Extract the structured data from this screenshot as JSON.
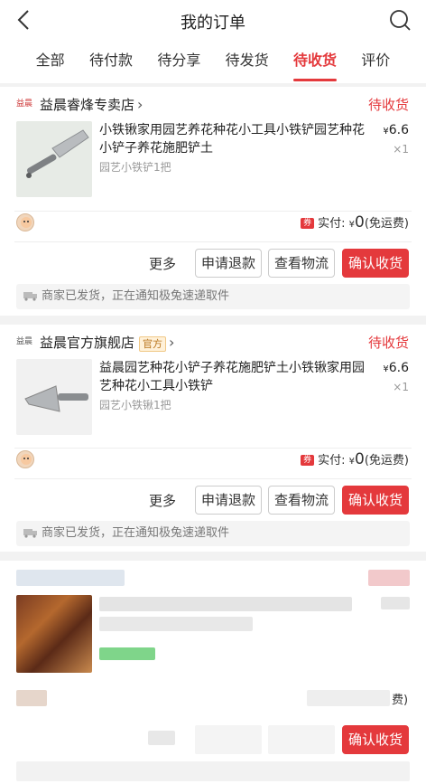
{
  "header": {
    "title": "我的订单",
    "back_icon": "back-chevron-icon",
    "search_icon": "search-icon"
  },
  "tabs": [
    {
      "label": "全部",
      "active": false
    },
    {
      "label": "待付款",
      "active": false
    },
    {
      "label": "待分享",
      "active": false
    },
    {
      "label": "待发货",
      "active": false
    },
    {
      "label": "待收货",
      "active": true
    },
    {
      "label": "评价",
      "active": false
    }
  ],
  "orders": [
    {
      "shop_logo": "益晨",
      "shop_name": "益晨睿烽专卖店",
      "official_badge": "",
      "status": "待收货",
      "product_title": "小铁锹家用园艺养花种花小工具小铁铲园艺种花小铲子养花施肥铲土",
      "sku": "园艺小铁铲1把",
      "price_symbol": "¥",
      "price": "6.6",
      "qty": "×1",
      "coupon_tag": "券",
      "paid_label": "实付: ",
      "paid_symbol": "¥",
      "paid_amount": "0",
      "shipping_note": "(免运费)",
      "more": "更多",
      "btn_refund": "申请退款",
      "btn_logistics": "查看物流",
      "btn_confirm": "确认收货",
      "notice": "商家已发货，正在通知极兔速递取件"
    },
    {
      "shop_logo": "益晨",
      "shop_name": "益晨官方旗舰店",
      "official_badge": "官方",
      "status": "待收货",
      "product_title": "益晨园艺种花小铲子养花施肥铲土小铁锹家用园艺种花小工具小铁铲",
      "sku": "园艺小铁锹1把",
      "price_symbol": "¥",
      "price": "6.6",
      "qty": "×1",
      "coupon_tag": "券",
      "paid_label": "实付: ",
      "paid_symbol": "¥",
      "paid_amount": "0",
      "shipping_note": "(免运费)",
      "more": "更多",
      "btn_refund": "申请退款",
      "btn_logistics": "查看物流",
      "btn_confirm": "确认收货",
      "notice": "商家已发货，正在通知极兔速递取件"
    }
  ],
  "order3": {
    "tail_text": "费)",
    "btn_confirm": "确认收货"
  },
  "colors": {
    "accent": "#e4393c",
    "badge_bg": "#fff1d9"
  }
}
